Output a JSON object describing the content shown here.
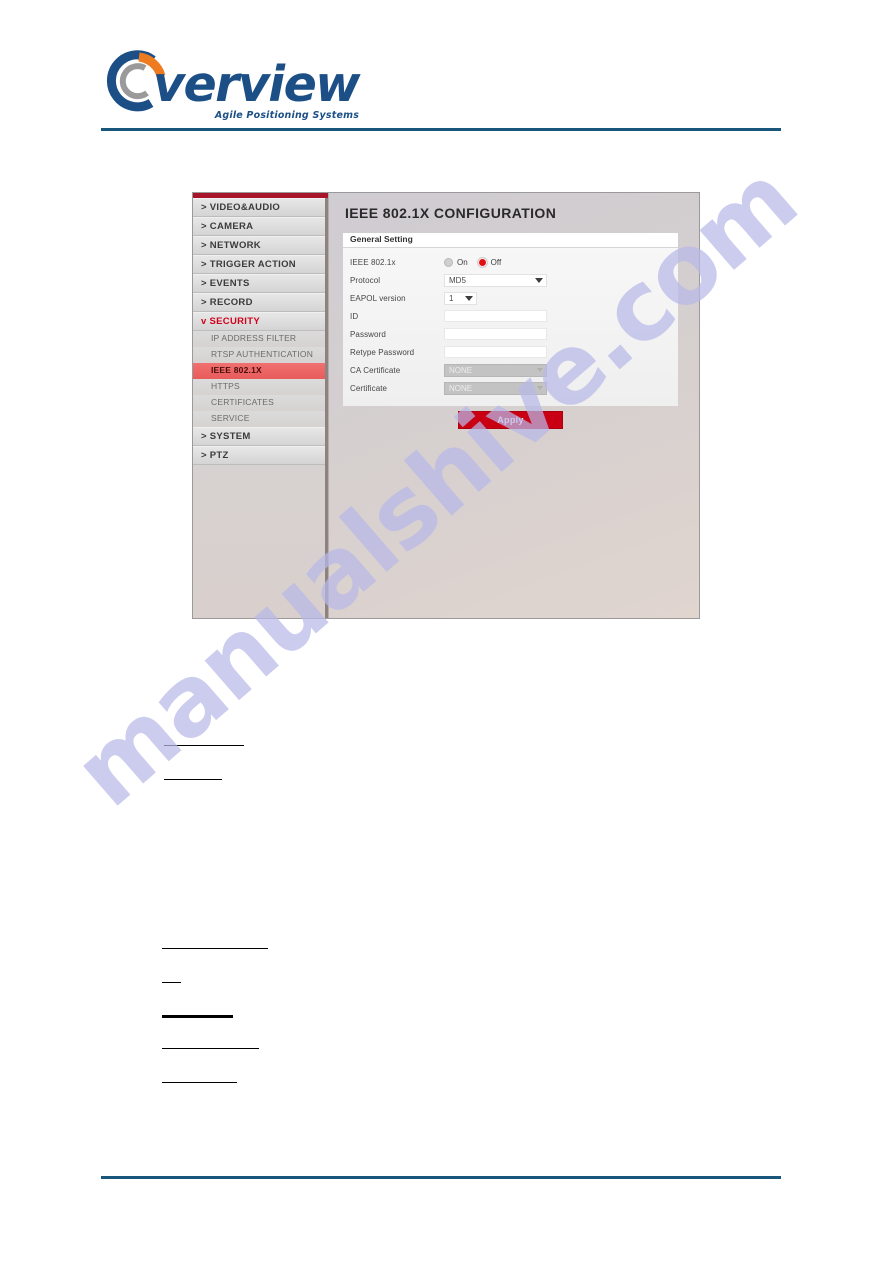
{
  "header": {
    "logo_word": "verview",
    "logo_tagline": "Agile Positioning Systems",
    "logo_icon": "overview-circle-logo-icon",
    "rule_color": "#18567c"
  },
  "watermark": {
    "text": "manualshive.com"
  },
  "device_ui": {
    "sidebar": {
      "top_level": [
        {
          "label": "> VIDEO&AUDIO",
          "name": "videoaudio",
          "expanded": false
        },
        {
          "label": "> CAMERA",
          "name": "camera",
          "expanded": false
        },
        {
          "label": "> NETWORK",
          "name": "network",
          "expanded": false
        },
        {
          "label": "> TRIGGER ACTION",
          "name": "trigger-action",
          "expanded": false
        },
        {
          "label": "> EVENTS",
          "name": "events",
          "expanded": false
        },
        {
          "label": "> RECORD",
          "name": "record",
          "expanded": false
        },
        {
          "label": "v SECURITY",
          "name": "security",
          "expanded": true
        }
      ],
      "security_children": [
        {
          "label": "IP ADDRESS FILTER",
          "name": "ip-address-filter",
          "active": false
        },
        {
          "label": "RTSP AUTHENTICATION",
          "name": "rtsp-authentication",
          "active": false
        },
        {
          "label": "IEEE 802.1X",
          "name": "ieee-802-1x",
          "active": true
        },
        {
          "label": "HTTPS",
          "name": "https",
          "active": false
        },
        {
          "label": "CERTIFICATES",
          "name": "certificates",
          "active": false
        },
        {
          "label": "SERVICE",
          "name": "service",
          "active": false
        }
      ],
      "bottom_level": [
        {
          "label": "> SYSTEM",
          "name": "system",
          "expanded": false
        },
        {
          "label": "> PTZ",
          "name": "ptz",
          "expanded": false
        }
      ]
    },
    "content": {
      "title": "IEEE 802.1X CONFIGURATION",
      "card_title": "General Setting",
      "fields": {
        "ieee8021x": {
          "label": "IEEE 802.1x",
          "options": [
            {
              "label": "On",
              "selected": false
            },
            {
              "label": "Off",
              "selected": true
            }
          ]
        },
        "protocol": {
          "label": "Protocol",
          "value": "MD5"
        },
        "eapol_version": {
          "label": "EAPOL version",
          "value": "1"
        },
        "id": {
          "label": "ID",
          "value": "",
          "placeholder": ""
        },
        "password": {
          "label": "Password",
          "value": "",
          "placeholder": ""
        },
        "retype_password": {
          "label": "Retype Password",
          "value": "",
          "placeholder": ""
        },
        "ca_certificate": {
          "label": "CA Certificate",
          "value": "NONE",
          "disabled": true
        },
        "certificate": {
          "label": "Certificate",
          "value": "NONE",
          "disabled": true
        }
      },
      "apply_label": "Apply",
      "accent_color": "#c90014",
      "active_nav_color": "#e95b5b"
    }
  }
}
